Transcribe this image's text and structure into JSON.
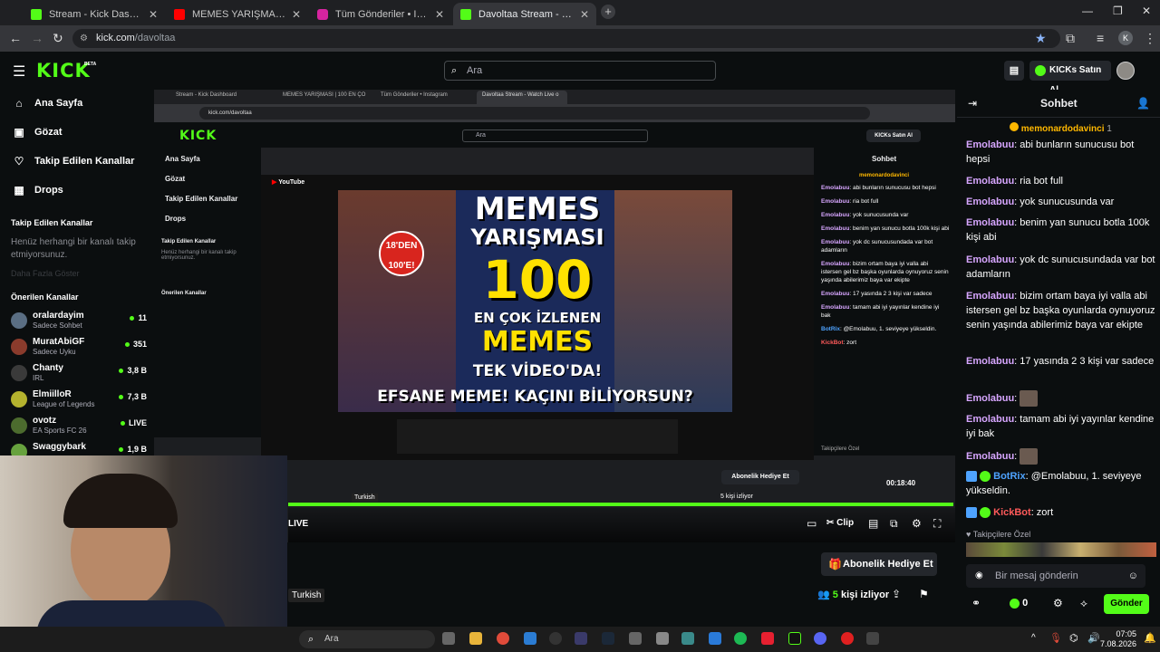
{
  "browser": {
    "tabs": [
      {
        "title": "Stream - Kick Dashboard",
        "color": "#53fc18"
      },
      {
        "title": "MEMES YARIŞMASI | 100 EN ÇO",
        "color": "#ff0000"
      },
      {
        "title": "Tüm Gönderiler • Instagram",
        "color": "#d6249f"
      },
      {
        "title": "Davoltaa Stream - Watch Live o",
        "color": "#53fc18",
        "active": true
      }
    ],
    "url_host": "kick.com",
    "url_path": "/davoltaa",
    "profile_initial": "K"
  },
  "kick": {
    "logo": "KICK",
    "logo_sup": "BETA",
    "search_placeholder": "Ara",
    "buy_kicks": "KICKs Satın Al"
  },
  "sidebar": {
    "nav": [
      {
        "label": "Ana Sayfa",
        "icon": "home-icon"
      },
      {
        "label": "Gözat",
        "icon": "browse-icon"
      },
      {
        "label": "Takip Edilen Kanallar",
        "icon": "heart-icon"
      },
      {
        "label": "Drops",
        "icon": "drops-icon"
      }
    ],
    "following_title": "Takip Edilen Kanallar",
    "following_empty": "Henüz herhangi bir kanalı takip etmiyorsunuz.",
    "following_more": "Daha Fazla Göster",
    "recommended_title": "Önerilen Kanallar",
    "channels": [
      {
        "name": "oralardayim",
        "category": "Sadece Sohbet",
        "viewers": "11",
        "color": "#5a6e83"
      },
      {
        "name": "MuratAbiGF",
        "category": "Sadece Uyku",
        "viewers": "351",
        "color": "#8a3b2c"
      },
      {
        "name": "Chanty",
        "category": "IRL",
        "viewers": "3,8 B",
        "color": "#3a3a3a"
      },
      {
        "name": "ElmiilloR",
        "category": "League of Legends",
        "viewers": "7,3 B",
        "color": "#b4b22e"
      },
      {
        "name": "ovotz",
        "category": "EA Sports FC 26",
        "viewers": "LIVE",
        "color": "#4c6b2e"
      },
      {
        "name": "Swaggybark",
        "category": "",
        "viewers": "1,9 B",
        "color": "#67a23e"
      }
    ]
  },
  "video": {
    "nested_tabs": [
      "Stream - Kick Dashboard",
      "MEMES YARIŞMASI | 100 EN ÇO",
      "Tüm Gönderiler • Instagram",
      "Davoltaa Stream - Watch Live o"
    ],
    "thumb_line1": "MEMES",
    "thumb_line2": "YARIŞMASI",
    "thumb_badge": "18'DEN 100'E!",
    "thumb_num": "100",
    "thumb_line3": "EN ÇOK İZLENEN",
    "thumb_line4": "MEMES",
    "thumb_line5": "TEK VİDEO'DA!",
    "thumb_bottom": "EFSANE MEME! KAÇINI BİLİYORSUN?",
    "youtube": "YouTube",
    "live": "LIVE",
    "clip": "Clip",
    "gift_button": "Abonelik Hediye Et",
    "language": "Turkish",
    "viewers_num": "5",
    "viewers_text": "kişi izliyor",
    "nested_timer": "00:18:40"
  },
  "chat": {
    "title": "Sohbet",
    "pinned_user": "memonardodavinci",
    "pinned_count": "1",
    "messages": [
      {
        "user": "Emolabuu",
        "text": ": abi bunların sunucusu bot hepsi"
      },
      {
        "user": "Emolabuu",
        "text": ": ria bot full"
      },
      {
        "user": "Emolabuu",
        "text": ": yok sunucusunda var"
      },
      {
        "user": "Emolabuu",
        "text": ": benim yan sunucu botla 100k kişi abi"
      },
      {
        "user": "Emolabuu",
        "text": ": yok dc sunucusundada var bot adamların"
      },
      {
        "user": "Emolabuu",
        "text": ": bizim ortam baya iyi valla abi istersen gel bz başka oyunlarda oynuyoruz senin yaşında abilerimiz baya var ekipte"
      },
      {
        "user": "Emolabuu",
        "text": ": 17 yasında 2 3 kişi var sadece"
      },
      {
        "user": "Emolabuu",
        "text": ":"
      },
      {
        "user": "Emolabuu",
        "text": ": tamam abi iyi yayınlar kendine iyi bak"
      },
      {
        "user": "Emolabuu",
        "text": ":"
      },
      {
        "user": "BotRix",
        "text": ": @Emolabuu, 1. seviyeye yükseldin."
      },
      {
        "user": "KickBot",
        "text": ": zort"
      }
    ],
    "followers_emotes_label": "Takipçilere Özel",
    "input_placeholder": "Bir mesaj gönderin",
    "kicks_count": "0",
    "send_button": "Gönder"
  },
  "taskbar": {
    "search": "Ara",
    "time": "07:05",
    "date": "7.08.2026"
  }
}
